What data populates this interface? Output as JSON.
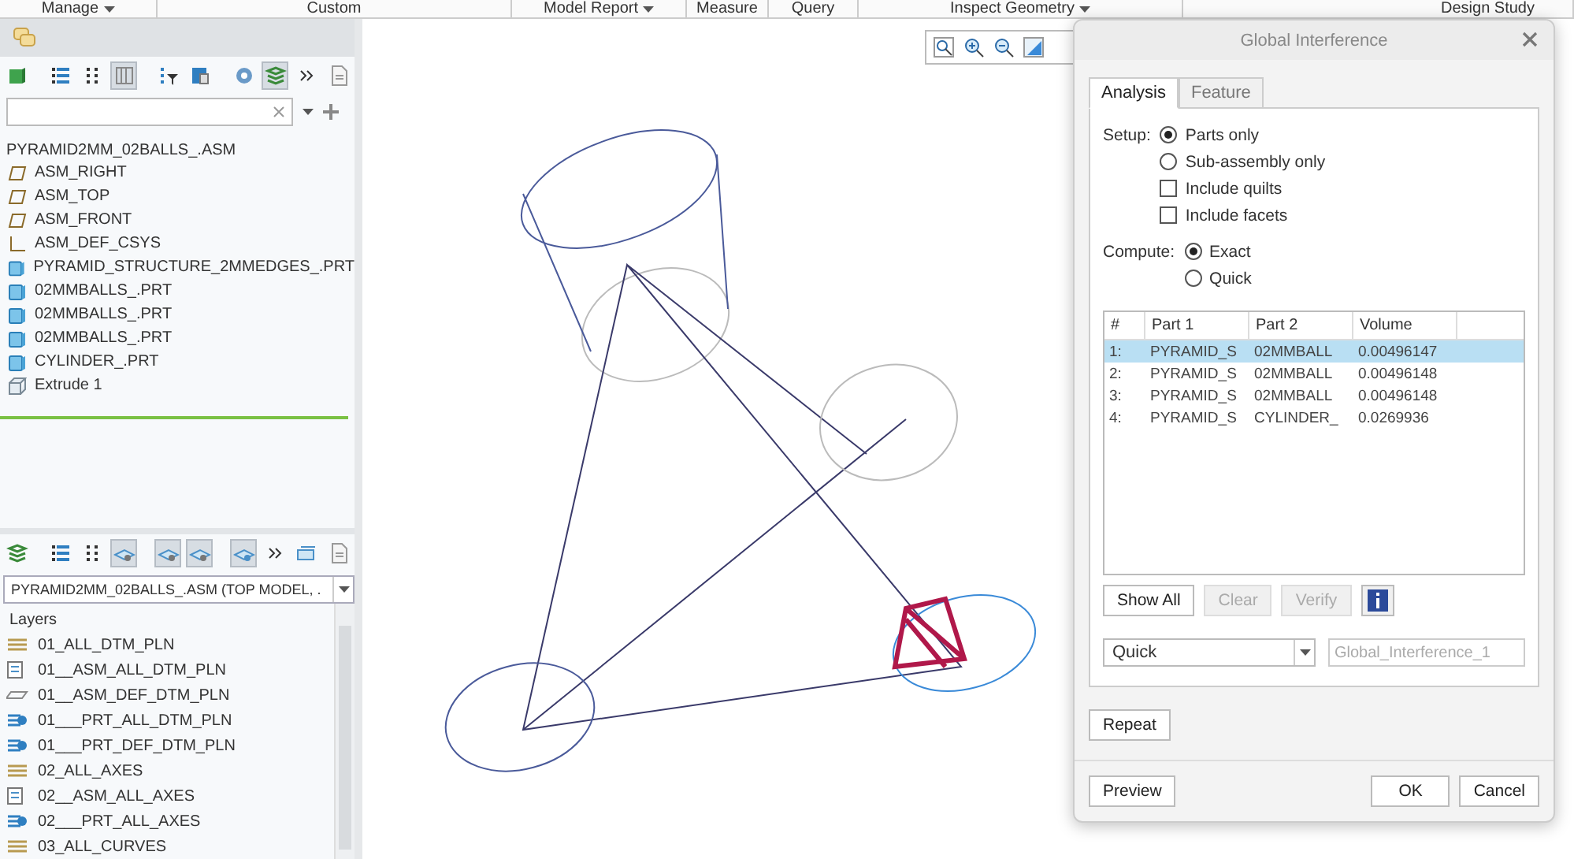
{
  "ribbon": [
    {
      "label": "Manage",
      "dropdown": true
    },
    {
      "label": "Custom",
      "dropdown": false
    },
    {
      "label": "Model Report",
      "dropdown": true
    },
    {
      "label": "Measure",
      "dropdown": false
    },
    {
      "label": "Query",
      "dropdown": false
    },
    {
      "label": "Inspect Geometry",
      "dropdown": true
    },
    {
      "label": "Design Study",
      "dropdown": false
    }
  ],
  "model_tree": {
    "toolbar": [
      {
        "kind": "part",
        "pressed": false
      },
      {
        "kind": "list",
        "pressed": false
      },
      {
        "kind": "dots",
        "pressed": false
      },
      {
        "kind": "columns",
        "pressed": true
      },
      {
        "kind": "filter",
        "pressed": false
      },
      {
        "kind": "table",
        "pressed": false
      },
      {
        "kind": "gear",
        "pressed": false
      },
      {
        "kind": "layers",
        "pressed": true
      },
      {
        "kind": "more",
        "pressed": false
      },
      {
        "kind": "doc",
        "pressed": false
      }
    ],
    "root": "PYRAMID2MM_02BALLS_.ASM",
    "items": [
      {
        "label": "ASM_RIGHT",
        "kind": "plane"
      },
      {
        "label": "ASM_TOP",
        "kind": "plane"
      },
      {
        "label": "ASM_FRONT",
        "kind": "plane"
      },
      {
        "label": "ASM_DEF_CSYS",
        "kind": "csys"
      },
      {
        "label": "PYRAMID_STRUCTURE_2MMEDGES_.PRT",
        "kind": "part"
      },
      {
        "label": "02MMBALLS_.PRT",
        "kind": "part"
      },
      {
        "label": "02MMBALLS_.PRT",
        "kind": "part"
      },
      {
        "label": "02MMBALLS_.PRT",
        "kind": "part"
      },
      {
        "label": "CYLINDER_.PRT",
        "kind": "part"
      },
      {
        "label": "Extrude 1",
        "kind": "extrude"
      }
    ]
  },
  "layer_tree": {
    "toolbar": [
      {
        "kind": "layers",
        "pressed": false
      },
      {
        "kind": "list",
        "pressed": false
      },
      {
        "kind": "dots",
        "pressed": false
      },
      {
        "kind": "layer-eye",
        "pressed": true
      },
      {
        "kind": "layer-a",
        "pressed": true
      },
      {
        "kind": "layer-b",
        "pressed": true
      },
      {
        "kind": "layer-c",
        "pressed": true
      },
      {
        "kind": "more",
        "pressed": false
      },
      {
        "kind": "layer-doc",
        "pressed": false
      },
      {
        "kind": "doc",
        "pressed": false
      }
    ],
    "model_select": "PYRAMID2MM_02BALLS_.ASM (TOP MODEL, .",
    "header": "Layers",
    "items": [
      {
        "label": "01_ALL_DTM_PLN",
        "kind": "stack"
      },
      {
        "label": "01__ASM_ALL_DTM_PLN",
        "kind": "rule"
      },
      {
        "label": "01__ASM_DEF_DTM_PLN",
        "kind": "plane"
      },
      {
        "label": "01___PRT_ALL_DTM_PLN",
        "kind": "blue"
      },
      {
        "label": "01___PRT_DEF_DTM_PLN",
        "kind": "blue"
      },
      {
        "label": "02_ALL_AXES",
        "kind": "stack"
      },
      {
        "label": "02__ASM_ALL_AXES",
        "kind": "rule"
      },
      {
        "label": "02___PRT_ALL_AXES",
        "kind": "blue"
      },
      {
        "label": "03_ALL_CURVES",
        "kind": "stack"
      }
    ]
  },
  "dialog": {
    "title": "Global Interference",
    "tabs": [
      {
        "label": "Analysis",
        "selected": true
      },
      {
        "label": "Feature",
        "selected": false
      }
    ],
    "setup": {
      "label": "Setup:",
      "options": [
        {
          "kind": "radio",
          "label": "Parts only",
          "selected": true
        },
        {
          "kind": "radio",
          "label": "Sub-assembly only",
          "selected": false
        },
        {
          "kind": "checkbox",
          "label": "Include quilts",
          "selected": false
        },
        {
          "kind": "checkbox",
          "label": "Include facets",
          "selected": false
        }
      ]
    },
    "compute": {
      "label": "Compute:",
      "options": [
        {
          "kind": "radio",
          "label": "Exact",
          "selected": true
        },
        {
          "kind": "radio",
          "label": "Quick",
          "selected": false
        }
      ]
    },
    "table": {
      "columns": [
        "#",
        "Part 1",
        "Part 2",
        "Volume"
      ],
      "rows": [
        {
          "cells": [
            "1:",
            "PYRAMID_S",
            "02MMBALL",
            "0.00496147"
          ],
          "selected": true
        },
        {
          "cells": [
            "2:",
            "PYRAMID_S",
            "02MMBALL",
            "0.00496148"
          ],
          "selected": false
        },
        {
          "cells": [
            "3:",
            "PYRAMID_S",
            "02MMBALL",
            "0.00496148"
          ],
          "selected": false
        },
        {
          "cells": [
            "4:",
            "PYRAMID_S",
            "CYLINDER_",
            "0.0269936"
          ],
          "selected": false
        }
      ]
    },
    "actions": [
      {
        "label": "Show All",
        "disabled": false
      },
      {
        "label": "Clear",
        "disabled": true
      },
      {
        "label": "Verify",
        "disabled": true
      }
    ],
    "mode_select": "Quick",
    "name_field": {
      "value": "Global_Interference_1",
      "disabled": true
    },
    "repeat": "Repeat",
    "footer": [
      {
        "label": "Preview",
        "kind": "left"
      },
      {
        "label": "OK",
        "kind": "right"
      },
      {
        "label": "Cancel",
        "kind": "right"
      }
    ]
  }
}
